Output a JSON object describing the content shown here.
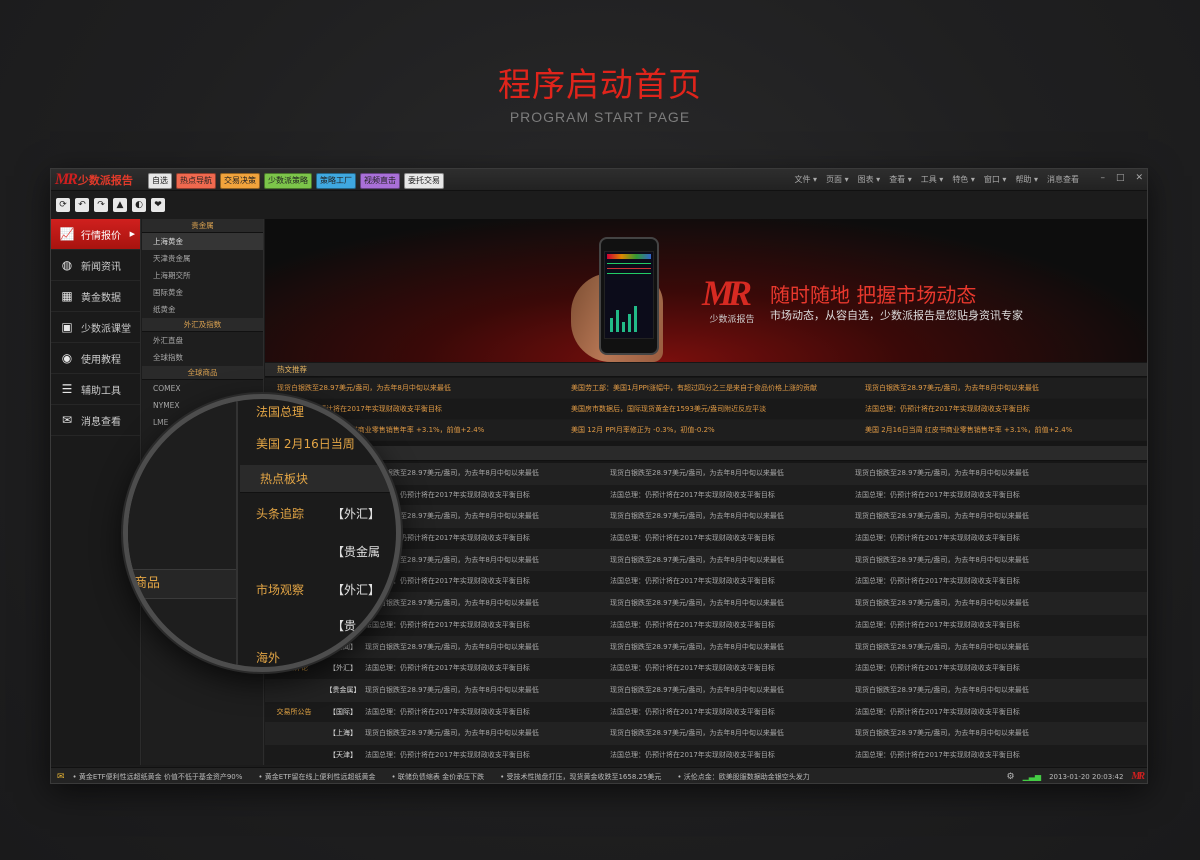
{
  "hero": {
    "title": "程序启动首页",
    "subtitle": "PROGRAM START PAGE"
  },
  "app": {
    "logo_mark": "MR",
    "logo_text": "少数派报告",
    "nav_buttons": [
      {
        "label": "自选",
        "color": "#e8e8e8"
      },
      {
        "label": "热点导航",
        "color": "#f0694f"
      },
      {
        "label": "交易决策",
        "color": "#f0a33c"
      },
      {
        "label": "少数派策略",
        "color": "#7cc54a"
      },
      {
        "label": "策略工厂",
        "color": "#3fa8e0"
      },
      {
        "label": "视频直击",
        "color": "#a970d8"
      },
      {
        "label": "委托交易",
        "color": "#e8e8e8"
      }
    ],
    "menus": [
      "文件",
      "页面",
      "图表",
      "查看",
      "工具",
      "特色",
      "窗口",
      "帮助",
      "消息查看"
    ],
    "window_controls": [
      "–",
      "□",
      "✕"
    ]
  },
  "toolbar": [
    "⟳",
    "↶",
    "↷",
    "▲",
    "◐",
    "❤"
  ],
  "left_nav": [
    {
      "label": "行情报价",
      "icon": "chart-line-icon",
      "glyph": "📈",
      "active": true
    },
    {
      "label": "新闻资讯",
      "icon": "globe-icon",
      "glyph": "◍",
      "active": false
    },
    {
      "label": "黄金数据",
      "icon": "table-icon",
      "glyph": "▦",
      "active": false
    },
    {
      "label": "少数派课堂",
      "icon": "screen-icon",
      "glyph": "▣",
      "active": false
    },
    {
      "label": "使用教程",
      "icon": "bulb-icon",
      "glyph": "◉",
      "active": false
    },
    {
      "label": "辅助工具",
      "icon": "list-icon",
      "glyph": "☰",
      "active": false
    },
    {
      "label": "消息查看",
      "icon": "chat-icon",
      "glyph": "✉",
      "active": false
    }
  ],
  "sub_nav": {
    "groups": [
      {
        "title": "贵金属",
        "items": [
          "上海黄金",
          "天津贵金属",
          "上海期交所",
          "国际黄金",
          "纸黄金"
        ]
      },
      {
        "title": "外汇及指数",
        "items": [
          "外汇直盘",
          "全球指数"
        ]
      },
      {
        "title": "全球商品",
        "items": [
          "COMEX",
          "NYMEX",
          "LME"
        ]
      }
    ]
  },
  "banner": {
    "logo_mark": "MR",
    "logo_sub": "少数派报告",
    "title": "随时随地 把握市场动态",
    "desc": "市场动态，从容自选，少数派报告是您贴身资讯专家"
  },
  "hot_news": {
    "title": "热文推荐",
    "rows": [
      [
        "现货白银跌至28.97美元/盎司，为去年8月中旬以来最低",
        "美国劳工部：美国1月PPI涨幅中，有超过四分之三是来自于食品价格上涨的贡献",
        "现货白银跌至28.97美元/盎司，为去年8月中旬以来最低"
      ],
      [
        "法国总理：仍预计将在2017年实现财政收支平衡目标",
        "美国房市数据后，国际现货黄金在1593美元/盎司附近反应平淡",
        "法国总理：仍预计将在2017年实现财政收支平衡目标"
      ],
      [
        "美国 2月16日当周 红皮书商业零售销售年率 +3.1%，前值+2.4%",
        "美国 12月 PPI月率修正为 -0.3%，初值-0.2%",
        "美国 2月16日当周 红皮书商业零售销售年率 +3.1%，前值+2.4%"
      ]
    ]
  },
  "hot_sector": {
    "title": "热点板块",
    "rows": [
      {
        "cat": "头条追踪",
        "tag": "【外汇】",
        "cells": [
          "现货白银跌至28.97美元/盎司，为去年8月中旬以来最低",
          "现货白银跌至28.97美元/盎司，为去年8月中旬以来最低",
          "现货白银跌至28.97美元/盎司，为去年8月中旬以来最低"
        ]
      },
      {
        "cat": "",
        "tag": "",
        "cells": [
          "法国总理：仍预计将在2017年实现财政收支平衡目标",
          "法国总理：仍预计将在2017年实现财政收支平衡目标",
          "法国总理：仍预计将在2017年实现财政收支平衡目标"
        ]
      },
      {
        "cat": "",
        "tag": "【贵金属】",
        "cells": [
          "现货白银跌至28.97美元/盎司，为去年8月中旬以来最低",
          "现货白银跌至28.97美元/盎司，为去年8月中旬以来最低",
          "现货白银跌至28.97美元/盎司，为去年8月中旬以来最低"
        ]
      },
      {
        "cat": "",
        "tag": "",
        "cells": [
          "法国总理：仍预计将在2017年实现财政收支平衡目标",
          "法国总理：仍预计将在2017年实现财政收支平衡目标",
          "法国总理：仍预计将在2017年实现财政收支平衡目标"
        ]
      },
      {
        "cat": "市场观察",
        "tag": "【外汇】",
        "cells": [
          "现货白银跌至28.97美元/盎司，为去年8月中旬以来最低",
          "现货白银跌至28.97美元/盎司，为去年8月中旬以来最低",
          "现货白银跌至28.97美元/盎司，为去年8月中旬以来最低"
        ]
      },
      {
        "cat": "",
        "tag": "",
        "cells": [
          "法国总理：仍预计将在2017年实现财政收支平衡目标",
          "法国总理：仍预计将在2017年实现财政收支平衡目标",
          "法国总理：仍预计将在2017年实现财政收支平衡目标"
        ]
      },
      {
        "cat": "",
        "tag": "【贵金属】",
        "cells": [
          "现货白银跌至28.97美元/盎司，为去年8月中旬以来最低",
          "现货白银跌至28.97美元/盎司，为去年8月中旬以来最低",
          "现货白银跌至28.97美元/盎司，为去年8月中旬以来最低"
        ]
      },
      {
        "cat": "",
        "tag": "",
        "cells": [
          "法国总理：仍预计将在2017年实现财政收支平衡目标",
          "法国总理：仍预计将在2017年实现财政收支平衡目标",
          "法国总理：仍预计将在2017年实现财政收支平衡目标"
        ]
      },
      {
        "cat": "",
        "tag": "【要闻】",
        "cells": [
          "现货白银跌至28.97美元/盎司，为去年8月中旬以来最低",
          "现货白银跌至28.97美元/盎司，为去年8月中旬以来最低",
          "现货白银跌至28.97美元/盎司，为去年8月中旬以来最低"
        ]
      },
      {
        "cat": "专家评论",
        "tag": "【外汇】",
        "cells": [
          "法国总理：仍预计将在2017年实现财政收支平衡目标",
          "法国总理：仍预计将在2017年实现财政收支平衡目标",
          "法国总理：仍预计将在2017年实现财政收支平衡目标"
        ]
      },
      {
        "cat": "",
        "tag": "【贵金属】",
        "cells": [
          "现货白银跌至28.97美元/盎司，为去年8月中旬以来最低",
          "现货白银跌至28.97美元/盎司，为去年8月中旬以来最低",
          "现货白银跌至28.97美元/盎司，为去年8月中旬以来最低"
        ]
      },
      {
        "cat": "交易所公告",
        "tag": "【国际】",
        "cells": [
          "法国总理：仍预计将在2017年实现财政收支平衡目标",
          "法国总理：仍预计将在2017年实现财政收支平衡目标",
          "法国总理：仍预计将在2017年实现财政收支平衡目标"
        ]
      },
      {
        "cat": "",
        "tag": "【上海】",
        "cells": [
          "现货白银跌至28.97美元/盎司，为去年8月中旬以来最低",
          "现货白银跌至28.97美元/盎司，为去年8月中旬以来最低",
          "现货白银跌至28.97美元/盎司，为去年8月中旬以来最低"
        ]
      },
      {
        "cat": "",
        "tag": "【天津】",
        "cells": [
          "法国总理：仍预计将在2017年实现财政收支平衡目标",
          "法国总理：仍预计将在2017年实现财政收支平衡目标",
          "法国总理：仍预计将在2017年实现财政收支平衡目标"
        ]
      }
    ]
  },
  "magnifier": {
    "line1": "法国总理",
    "line2": "美国 2月16日当周",
    "head": "热点板块",
    "cat1": "头条追踪",
    "tag1": "【外汇】",
    "tag2": "【贵金属",
    "cat2": "市场观察",
    "tag3": "【外汇】",
    "tag4": "【贵",
    "side_label": "商品",
    "cut_text": "海外"
  },
  "status": {
    "ticker": [
      "黄金ETF便利性远超纸黄金 价值不低于基金资产90%",
      "黄金ETF留在线上便利性远超纸黄金",
      "联储负债缩表 金价承压下跌",
      "受技术性抛盘打压，现货黄金收跌至1658.25美元",
      "沃伦点金：欧美股服数据助金银空头发力"
    ],
    "time": "2013-01-20 20:03:42",
    "mini_logo": "MR"
  }
}
